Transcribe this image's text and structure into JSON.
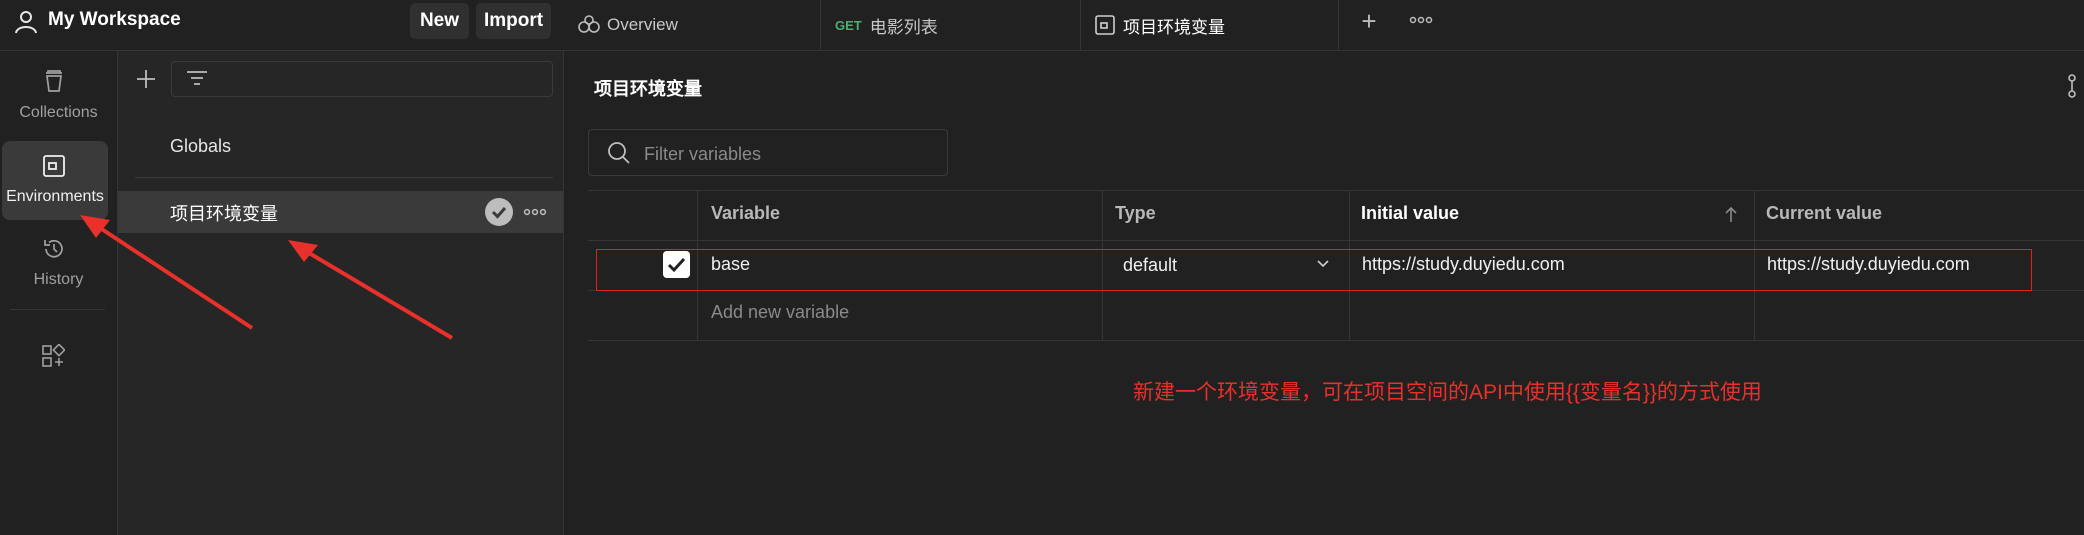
{
  "header": {
    "workspace_title": "My Workspace",
    "new_label": "New",
    "import_label": "Import"
  },
  "tabs": [
    {
      "label": "Overview",
      "icon": "overview-icon"
    },
    {
      "method": "GET",
      "label": "电影列表"
    },
    {
      "label": "项目环境变量",
      "icon": "environment-icon",
      "active": true
    }
  ],
  "sidebar": {
    "items": [
      {
        "label": "Collections",
        "icon": "collections-icon"
      },
      {
        "label": "Environments",
        "icon": "environments-icon",
        "active": true
      },
      {
        "label": "History",
        "icon": "history-icon"
      },
      {
        "label": "",
        "icon": "apps-icon"
      }
    ]
  },
  "environments": {
    "globals_label": "Globals",
    "items": [
      {
        "name": "项目环境变量",
        "active": true
      }
    ]
  },
  "main": {
    "title": "项目环境变量",
    "filter_placeholder": "Filter variables",
    "table": {
      "headers": [
        "Variable",
        "Type",
        "Initial value",
        "Current value"
      ],
      "rows": [
        {
          "checked": true,
          "variable": "base",
          "type": "default",
          "initial": "https://study.duyiedu.com",
          "current": "https://study.duyiedu.com"
        }
      ],
      "add_new_placeholder": "Add new variable"
    },
    "annotation": "新建一个环境变量，可在项目空间的API中使用{{变量名}}的方式使用"
  },
  "colors": {
    "background": "#212121",
    "panel": "#262626",
    "selected": "#3a3a3a",
    "annotation_red": "#e8312a",
    "get_green": "#4caf6e"
  }
}
